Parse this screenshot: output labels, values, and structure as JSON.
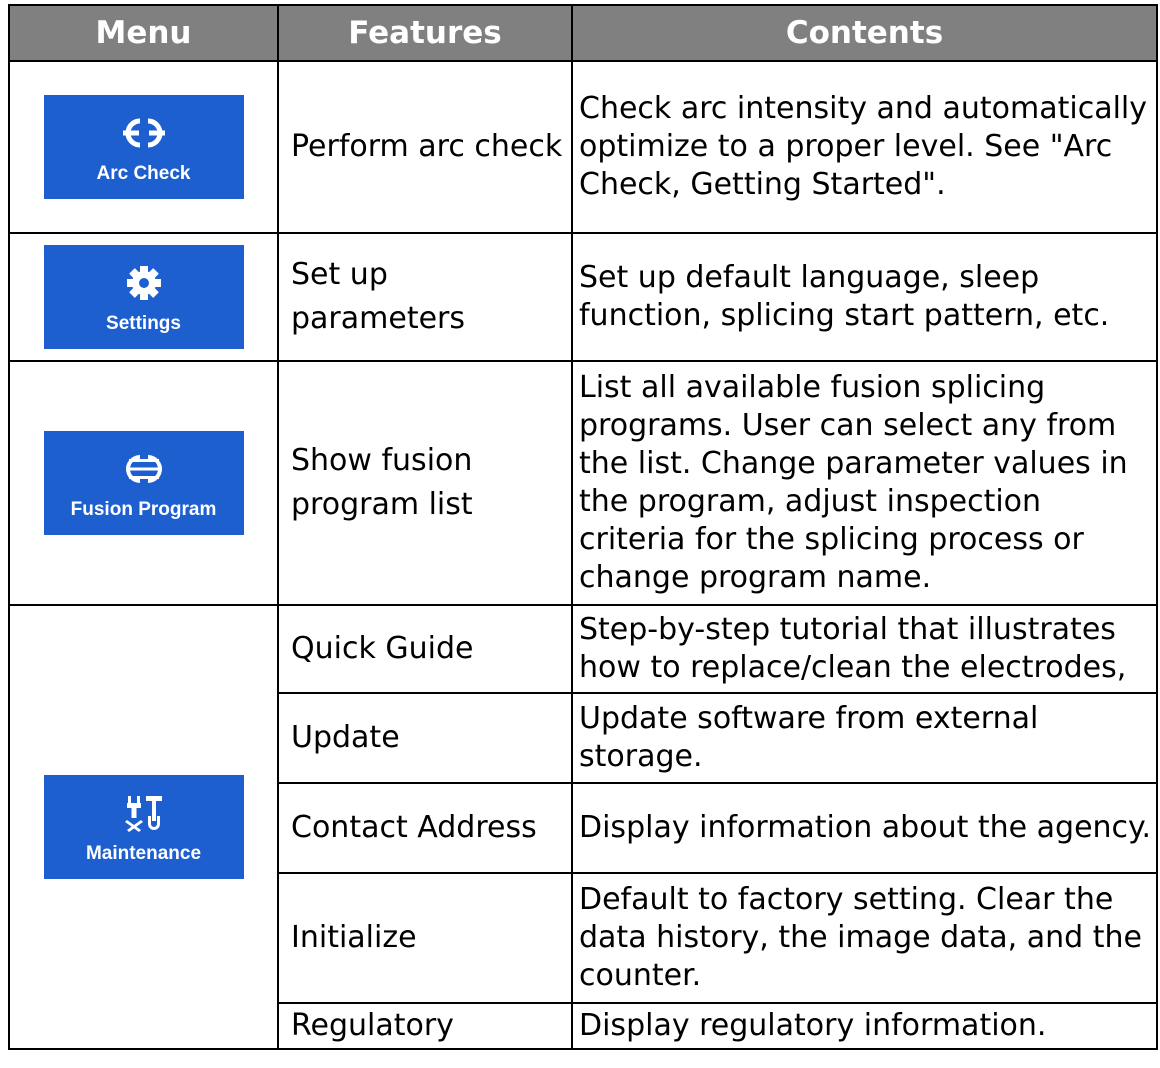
{
  "header": {
    "menu": "Menu",
    "features": "Features",
    "contents": "Contents"
  },
  "rows": [
    {
      "menu": {
        "label": "Arc Check",
        "icon": "arc-check-icon"
      },
      "feature": "Perform arc check",
      "contents": "Check arc intensity and automatically optimize to a proper level. See \"Arc Check, Getting Started\"."
    },
    {
      "menu": {
        "label": "Settings",
        "icon": "gear-icon"
      },
      "feature": "Set up parameters",
      "contents": "Set up default language, sleep function, splicing start pattern, etc."
    },
    {
      "menu": {
        "label": "Fusion Program",
        "icon": "fusion-program-icon"
      },
      "feature": "Show fusion program list",
      "contents": "List all available fusion splicing programs. User can select any from the list. Change parameter values in the program, adjust inspection criteria for the splicing process or change program name."
    }
  ],
  "maintenance": {
    "menu": {
      "label": "Maintenance",
      "icon": "maintenance-tools-icon"
    },
    "items": [
      {
        "feature": "Quick Guide",
        "contents": "Step-by-step tutorial that illustrates how to replace/clean the electrodes,"
      },
      {
        "feature": "Update",
        "contents": "Update software from external storage."
      },
      {
        "feature": "Contact Address",
        "contents": "Display information about the agency."
      },
      {
        "feature": "Initialize",
        "contents": "Default to factory setting. Clear the data history, the image data, and the counter."
      },
      {
        "feature": "Regulatory",
        "contents": "Display regulatory information."
      }
    ]
  },
  "colors": {
    "header_bg": "#808080",
    "button_bg": "#1e5fd0",
    "button_text": "#ffffff"
  }
}
